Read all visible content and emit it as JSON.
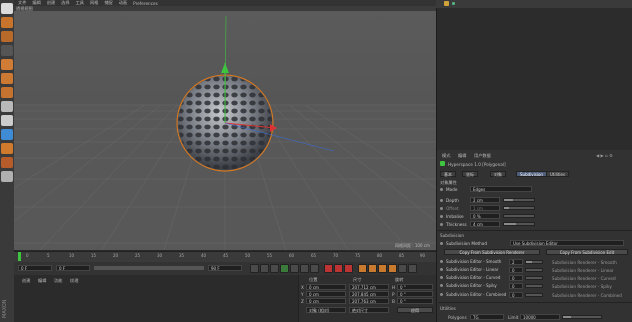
{
  "menu": {
    "items": [
      "文件",
      "编辑",
      "创建",
      "选择",
      "工具",
      "网格",
      "捕捉",
      "动画",
      "模拟",
      "渲染",
      "雕刻",
      "运动跟踪",
      "运动图形",
      "角色",
      "流水线",
      "插件",
      "脚本",
      "窗口",
      "帮助"
    ],
    "extra": "Preferences"
  },
  "viewport": {
    "label": "透视视图",
    "grid_spacing": "网格间距 : 100 cm"
  },
  "timeline": {
    "ticks": [
      "0",
      "5",
      "10",
      "15",
      "20",
      "25",
      "30",
      "35",
      "40",
      "45",
      "50",
      "55",
      "60",
      "65",
      "70",
      "75",
      "80",
      "85",
      "90"
    ],
    "frame_end": "0 F"
  },
  "transport": {
    "start": "0 F",
    "current": "0 F",
    "end": "90 F",
    "max": "90 F"
  },
  "material": {
    "tabs": [
      "创建",
      "编辑",
      "功能",
      "纹理"
    ]
  },
  "coords": {
    "headers": [
      "位置",
      "尺寸",
      "旋转"
    ],
    "rows": [
      {
        "axis": "X",
        "pos": "0 cm",
        "size": "207.712 cm",
        "rot_label": "H",
        "rot": "0 °"
      },
      {
        "axis": "Y",
        "pos": "0 cm",
        "size": "207.845 cm",
        "rot_label": "P",
        "rot": "0 °"
      },
      {
        "axis": "Z",
        "pos": "0 cm",
        "size": "207.763 cm",
        "rot_label": "B",
        "rot": "0 °"
      }
    ],
    "mode_select": "对象 (相对)",
    "size_select": "绝对尺寸",
    "apply": "应用"
  },
  "attributes": {
    "menu": [
      "模式",
      "编辑",
      "用户数据"
    ],
    "object_name": "Hyperspace 1.0 [Polygonal]",
    "tabs": [
      "基本",
      "坐标",
      "对象",
      "Subdivision",
      "Utilities"
    ],
    "active_tab": "Subdivision",
    "section_object": "对象属性",
    "mode_label": "Mode",
    "mode_value": "Edges",
    "depth_label": "Depth",
    "depth_value": "2 cm",
    "offset_label": "Offset",
    "offset_value": "1 cm",
    "polyline_label": "Imbalise",
    "polyline_value": "0 %",
    "thickness_label": "Thickness",
    "thickness_value": "4 cm",
    "section_subdivision": "Subdivision",
    "subdivision_method_label": "Subdivision Method",
    "subdivision_method_value": "Use Subdivision Editor",
    "copy_from_renderer": "Copy From Subdivision Renderer",
    "copy_from_editor": "Copy From Subdivision Edit",
    "editor_rows": [
      {
        "label": "Subdivision Editor - Smooth",
        "value": "2"
      },
      {
        "label": "Subdivision Editor - Linear",
        "value": "0"
      },
      {
        "label": "Subdivision Editor - Curved",
        "value": "0"
      },
      {
        "label": "Subdivision Editor - Spiky",
        "value": "0"
      },
      {
        "label": "Subdivision Editor - Combined",
        "value": "0"
      }
    ],
    "renderer_rows": [
      "Subdivision Renderer - Smooth",
      "Subdivision Renderer - Linear",
      "Subdivision Renderer - Curved",
      "Subdivision Renderer - Spiky",
      "Subdivision Renderer - Combined"
    ],
    "section_utilities": "Utilities",
    "polygons_label": "Polygons",
    "polygons_value": "TG",
    "limit_label": "Limit",
    "limit_value": "10000"
  },
  "colors": {
    "viewport_bg": "#555555",
    "accent": "#4d5d7a",
    "selection_orange": "#e07a1a"
  }
}
